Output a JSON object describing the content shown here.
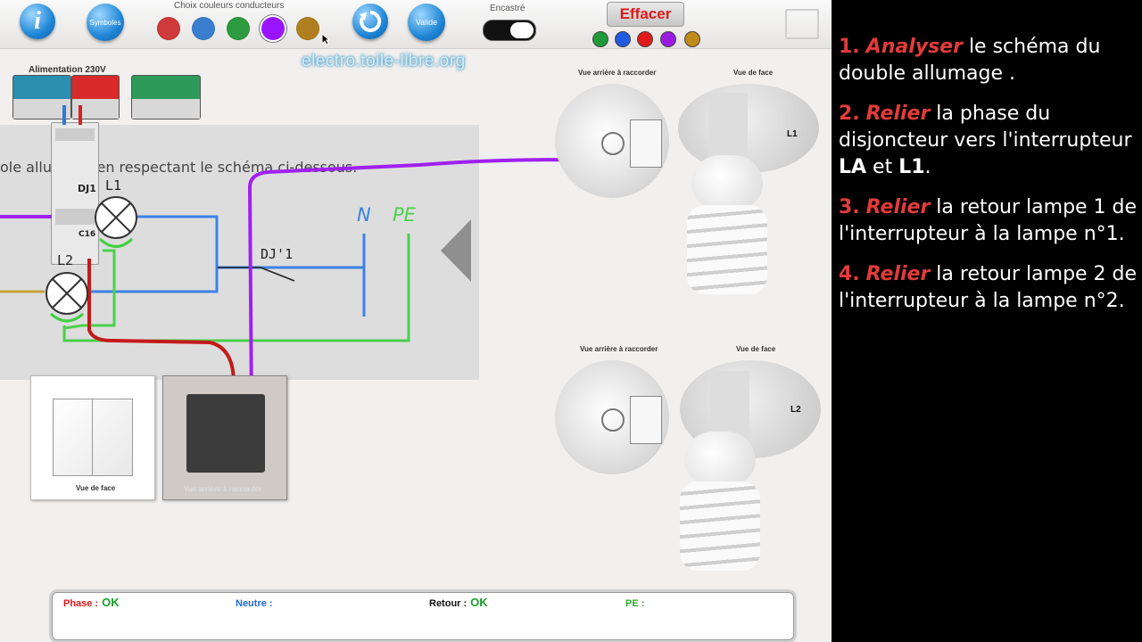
{
  "toolbar": {
    "info_label": "i",
    "symbols_label": "Symboles",
    "color_picker_title": "Choix couleurs conducteurs",
    "swatch_colors": [
      "#cf3a3a",
      "#3a7fcf",
      "#2c9a3f",
      "#9a14ff",
      "#b08020"
    ],
    "valid_label": "Valide",
    "encastre_label": "Encastré",
    "erase_label": "Effacer",
    "legend_colors": [
      "#1f9a3a",
      "#1f5be0",
      "#e01a1a",
      "#9a1ae0",
      "#c08a1a"
    ]
  },
  "watermark": "electro.toile-libre.org",
  "power": {
    "label": "Alimentation 230V"
  },
  "instruction": "ole allumage en respectant le schéma ci-dessous.",
  "schematic": {
    "breaker_label": "DJ1",
    "breaker_rating": "C16",
    "lamp1_label": "L1",
    "lamp2_label": "L2",
    "switch_label": "DJ'1",
    "neutral_label": "N",
    "earth_label": "PE"
  },
  "switch_cards": {
    "front_label": "Vue de face",
    "back_label": "Vue arrière à raccorder"
  },
  "lamps": [
    {
      "back_label": "Vue arrière à raccorder",
      "front_label": "Vue de face",
      "name": "L1"
    },
    {
      "back_label": "Vue arrière à raccorder",
      "front_label": "Vue de face",
      "name": "L2"
    }
  ],
  "status": {
    "phase_label": "Phase :",
    "phase_value": "OK",
    "neutral_label": "Neutre :",
    "neutral_value": "",
    "return_label": "Retour :",
    "return_value": "OK",
    "pe_label": "PE :",
    "pe_value": ""
  },
  "steps": [
    {
      "number": "1.",
      "verb": "Analyser",
      "text_a": " le schéma du double allumage ."
    },
    {
      "number": "2.",
      "verb": "Relier",
      "text_a": " la phase du disjoncteur vers l'interrupteur ",
      "bold1": "LA",
      "text_b": " et ",
      "bold2": "L1",
      "text_c": "."
    },
    {
      "number": "3.",
      "verb": "Relier",
      "text_a": " la retour lampe 1 de l'interrupteur à la lampe n°1."
    },
    {
      "number": "4.",
      "verb": "Relier",
      "text_a": " la retour lampe 2 de l'interrupteur à la lampe n°2."
    }
  ]
}
